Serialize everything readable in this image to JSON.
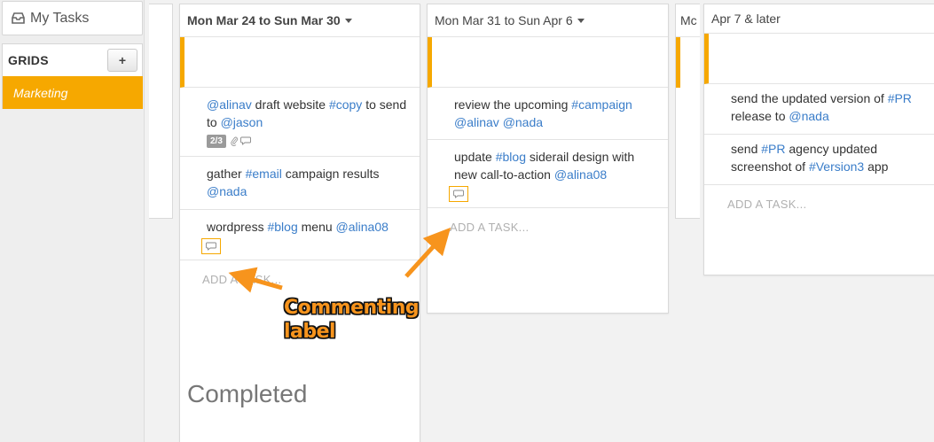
{
  "sidebar": {
    "my_tasks_label": "My Tasks",
    "grids_title": "GRIDS",
    "add_grid_label": "+",
    "grid_items": [
      {
        "label": "Marketing",
        "active": true
      }
    ]
  },
  "columns": [
    {
      "header": "Mon Mar 24 to Sun Mar 30",
      "tasks": [
        {
          "parts": [
            [
              "mention",
              "@alinav"
            ],
            [
              "text",
              " draft website "
            ],
            [
              "tag",
              "#copy"
            ],
            [
              "text",
              " to send to "
            ],
            [
              "mention",
              "@jason"
            ]
          ],
          "badge": "2/3",
          "attachment": true,
          "comment": true
        },
        {
          "parts": [
            [
              "text",
              "gather "
            ],
            [
              "tag",
              "#email"
            ],
            [
              "text",
              " campaign results "
            ],
            [
              "mention",
              "@nada"
            ]
          ]
        },
        {
          "parts": [
            [
              "text",
              "wordpress "
            ],
            [
              "tag",
              "#blog"
            ],
            [
              "text",
              " menu "
            ],
            [
              "mention",
              "@alina08"
            ]
          ],
          "comment_label": true
        }
      ],
      "add_task": "ADD A TASK...",
      "completed_label": "Completed"
    },
    {
      "header": "Mon Mar 31 to Sun Apr 6",
      "tasks": [
        {
          "parts": [
            [
              "text",
              "review the upcoming "
            ],
            [
              "tag",
              "#campaign"
            ],
            [
              "text",
              " "
            ],
            [
              "mention",
              "@alinav"
            ],
            [
              "text",
              " "
            ],
            [
              "mention",
              "@nada"
            ]
          ]
        },
        {
          "parts": [
            [
              "text",
              "update "
            ],
            [
              "tag",
              "#blog"
            ],
            [
              "text",
              " siderail design with new call-to-action "
            ],
            [
              "mention",
              "@alina08"
            ]
          ],
          "comment_label": true
        }
      ],
      "add_task": "ADD A TASK..."
    },
    {
      "header": "Apr 7 & later",
      "tasks": [
        {
          "parts": [
            [
              "text",
              "send the updated version of "
            ],
            [
              "tag",
              "#PR"
            ],
            [
              "text",
              " release to "
            ],
            [
              "mention",
              "@nada"
            ]
          ]
        },
        {
          "parts": [
            [
              "text",
              "send "
            ],
            [
              "tag",
              "#PR"
            ],
            [
              "text",
              " agency updated screenshot of "
            ],
            [
              "tag",
              "#Version3"
            ],
            [
              "text",
              " app"
            ]
          ]
        }
      ],
      "add_task": "ADD A TASK..."
    }
  ],
  "partial_header": "Mc",
  "annotation": {
    "line1": "Commenting",
    "line2": "label"
  },
  "colors": {
    "accent": "#f6a800",
    "link": "#3a7dc9",
    "annotation": "#f7941d"
  }
}
